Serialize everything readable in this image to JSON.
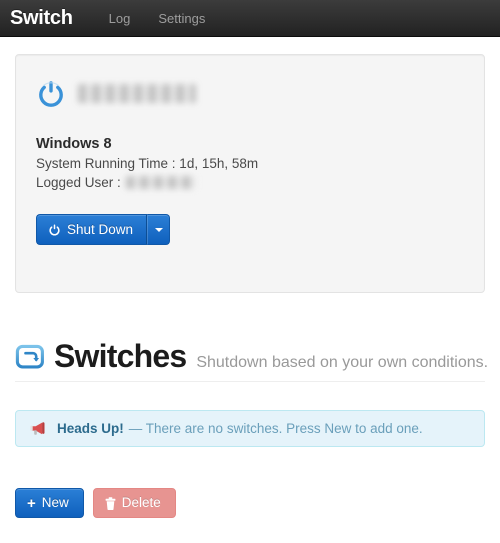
{
  "navbar": {
    "brand": "Switch",
    "links": [
      {
        "label": "Log",
        "name": "nav-link-log"
      },
      {
        "label": "Settings",
        "name": "nav-link-settings"
      }
    ]
  },
  "machine_panel": {
    "power_icon": "power-icon",
    "hostname_redacted": true,
    "os_name": "Windows 8",
    "running_time_line": "System Running Time : 1d, 15h, 58m",
    "logged_user_label": "Logged User :",
    "logged_user_redacted": true,
    "shutdown_button": {
      "label": "Shut Down",
      "icon": "power-icon",
      "caret_icon": "chevron-down-icon"
    }
  },
  "switches_section": {
    "icon": "repeat-loop-icon",
    "title": "Switches",
    "subtitle": "Shutdown based on your own conditions.",
    "alert": {
      "icon": "megaphone-icon",
      "strong": "Heads Up!",
      "message": "— There are no switches. Press New to add one."
    },
    "actions": {
      "new_label": "New",
      "new_icon": "plus-icon",
      "delete_label": "Delete",
      "delete_icon": "trash-icon"
    }
  },
  "colors": {
    "navbar_bg": "#222222",
    "brand_text": "#ffffff",
    "nav_link": "#9d9d9d",
    "primary_blue": "#1a6fc8",
    "icon_blue": "#3a92d8",
    "danger_red": "#d9534f",
    "alert_bg": "#e5f3fa",
    "alert_border": "#bce8f1",
    "alert_text": "#3a87ad",
    "well_bg": "#f5f5f5",
    "well_border": "#e3e3e3",
    "subtitle_gray": "#999999"
  }
}
